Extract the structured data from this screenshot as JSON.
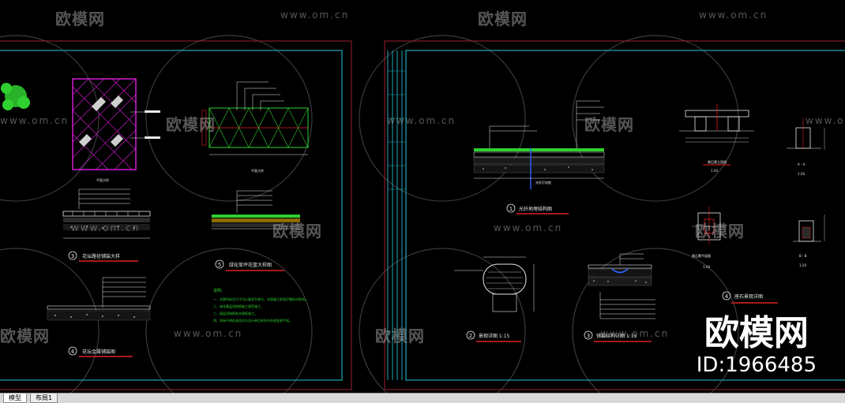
{
  "watermark": {
    "brand": "欧模网",
    "url": "www.om.cn",
    "url_short": "www.om.cn"
  },
  "logo": {
    "brand": "欧模网",
    "id": "ID:1966485"
  },
  "tabs": [
    {
      "label": "模型",
      "active": true
    },
    {
      "label": "布局1",
      "active": false
    }
  ],
  "left_sheet": {
    "detail3_num": "3",
    "detail3_title": "花坛路径铺装大样",
    "detail4_num": "4",
    "detail4_title": "花坛金属铺装图",
    "detail5_num": "5",
    "detail5_title": "绿化草坪花篮大样图",
    "plan_label_1": "平面大样",
    "plan_label_2": "平面大样",
    "notes_title": "说明:",
    "notes": [
      "一、本图所标注尺寸均以毫米为单位，本图施工前须仔细核对现场。",
      "二、绿化基层须按照施工规范施工。",
      "三、面层须按照有关图纸施工。",
      "四、如有不明处请及时与设计单位联系并办理变更手续。"
    ]
  },
  "right_sheet": {
    "detail1_num": "1",
    "detail1_title": "光纤地埋结构图",
    "detail2_num": "2",
    "detail2_title": "景观详图 1:15",
    "detail3_num": "3",
    "detail3_title": "铺装结构详图 1:15",
    "detail4_num": "4",
    "detail4_title": "座石景观详图",
    "aa_label": "A - A",
    "aa_scale": "1:20",
    "bb_label": "B - B",
    "bb_scale": "1:20",
    "elev_scale": "1:20",
    "plan_scale": "1:20",
    "plan_title": "景石凳平面图",
    "elev_title": "景石凳立面图",
    "cable_label": "光纤灯电缆"
  },
  "colors": {
    "frame": "#1aa8b8",
    "magenta": "#e020e0",
    "red": "#e02020",
    "green": "#30d030",
    "blue": "#3060ff",
    "white": "#e8e8e8",
    "grey": "#9a9a9a"
  }
}
